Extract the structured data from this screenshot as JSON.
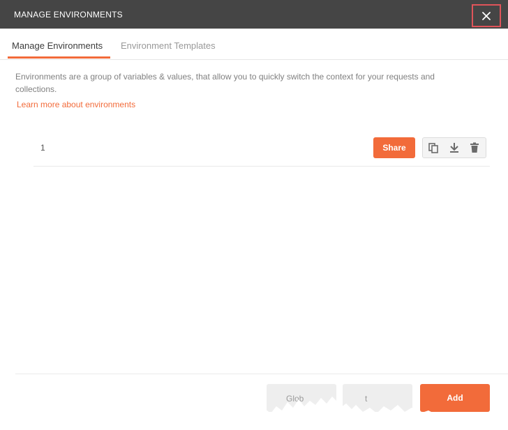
{
  "header": {
    "title": "MANAGE ENVIRONMENTS",
    "close_icon": "close-icon"
  },
  "tabs": [
    {
      "label": "Manage Environments",
      "active": true
    },
    {
      "label": "Environment Templates",
      "active": false
    }
  ],
  "description": "Environments are a group of variables & values, that allow you to quickly switch the context for your requests and collections.",
  "learn_more_label": "Learn more about environments",
  "environments": [
    {
      "name": "1",
      "share_label": "Share",
      "actions": [
        "duplicate-icon",
        "download-icon",
        "delete-icon"
      ]
    }
  ],
  "footer": {
    "globals_label": "Glob",
    "import_label": "t",
    "add_label": "Add"
  },
  "colors": {
    "accent": "#f26b3a",
    "header_bg": "#454545",
    "close_highlight": "#e0545a"
  }
}
